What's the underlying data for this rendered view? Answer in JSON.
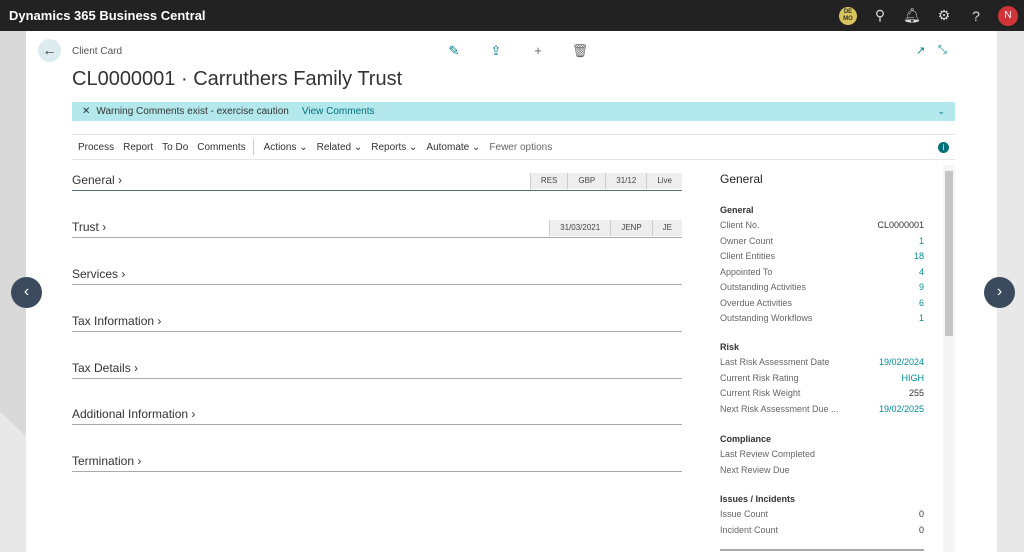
{
  "app": {
    "title": "Dynamics 365 Business Central",
    "company_badge": "DE MO",
    "user_initial": "N"
  },
  "page": {
    "breadcrumb": "Client Card",
    "title": "CL0000001 · Carruthers Family Trust"
  },
  "warning": {
    "text": "Warning Comments exist - exercise caution",
    "link": "View Comments"
  },
  "menu": {
    "items": [
      "Process",
      "Report",
      "To Do",
      "Comments"
    ],
    "dropdowns": [
      "Actions",
      "Related",
      "Reports",
      "Automate"
    ],
    "fewer": "Fewer options"
  },
  "sections": [
    {
      "label": "General",
      "tags": [
        "RES",
        "GBP",
        "31/12",
        "Live"
      ]
    },
    {
      "label": "Trust",
      "tags": [
        "31/03/2021",
        "JENP",
        "JE"
      ]
    },
    {
      "label": "Services"
    },
    {
      "label": "Tax Information"
    },
    {
      "label": "Tax Details"
    },
    {
      "label": "Additional Information"
    },
    {
      "label": "Termination"
    }
  ],
  "factbox": {
    "title": "General",
    "groups": [
      {
        "title": "General",
        "rows": [
          [
            "Client No.",
            "CL0000001"
          ],
          [
            "Owner Count",
            "1"
          ],
          [
            "Client Entities",
            "18"
          ],
          [
            "Appointed To",
            "4"
          ],
          [
            "Outstanding Activities",
            "9"
          ],
          [
            "Overdue Activities",
            "6"
          ],
          [
            "Outstanding Workflows",
            "1"
          ]
        ]
      },
      {
        "title": "Risk",
        "rows": [
          [
            "Last Risk Assessment Date",
            "19/02/2024"
          ],
          [
            "Current Risk Rating",
            "HIGH"
          ],
          [
            "Current Risk Weight",
            "255"
          ],
          [
            "Next Risk Assessment Due ...",
            "19/02/2025"
          ]
        ]
      },
      {
        "title": "Compliance",
        "rows": [
          [
            "Last Review Completed",
            ""
          ],
          [
            "Next Review Due",
            ""
          ]
        ]
      },
      {
        "title": "Issues / Incidents",
        "rows": [
          [
            "Issue Count",
            "0"
          ],
          [
            "Incident Count",
            "0"
          ]
        ]
      }
    ]
  }
}
